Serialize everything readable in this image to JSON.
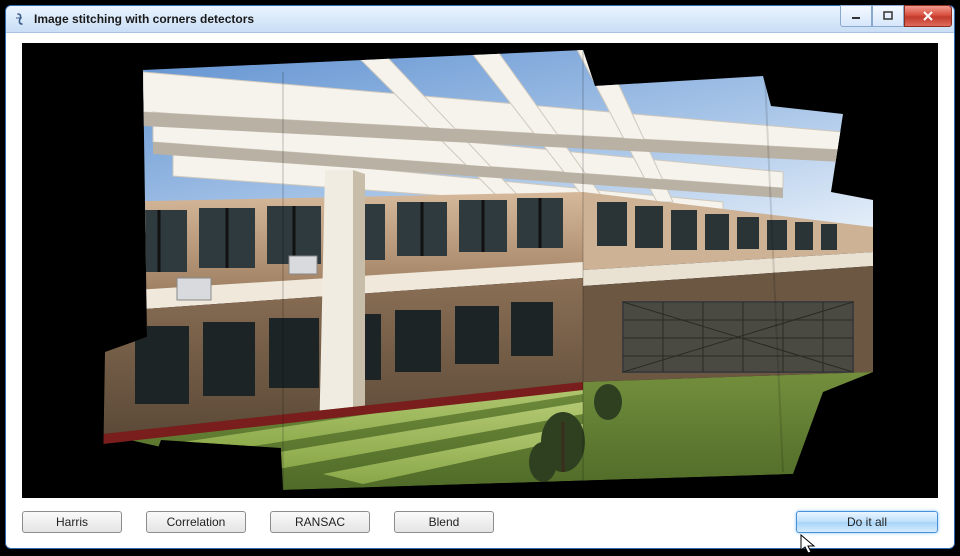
{
  "window": {
    "title": "Image stitching with corners detectors"
  },
  "buttons": {
    "harris": "Harris",
    "correlation": "Correlation",
    "ransac": "RANSAC",
    "blend": "Blend",
    "do_it_all": "Do it all"
  },
  "icons": {
    "app": "script-f-icon",
    "minimize": "minimize-icon",
    "maximize": "maximize-icon",
    "close": "close-icon"
  },
  "image": {
    "description": "Stitched panorama of a two-story building courtyard with a pergola casting shadows on grass; composed of multiple overlapping photos on black canvas."
  }
}
